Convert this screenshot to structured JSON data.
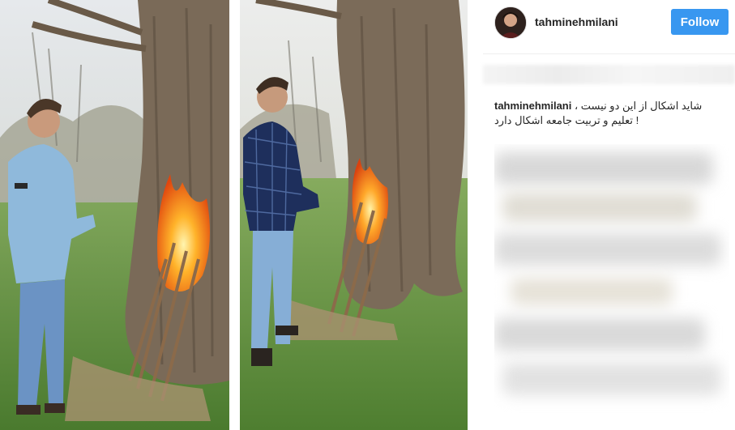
{
  "post": {
    "username": "tahminehmilani",
    "follow_label": "Follow",
    "caption_username": "tahminehmilani",
    "caption_line1": "شاید اشکال از این دو نیست ،",
    "caption_line2": "! تعلیم و تربیت جامعه اشکال دارد"
  },
  "photos": [
    {
      "name": "left-photo",
      "subject": "man in light denim shirt beside burning tree"
    },
    {
      "name": "right-photo",
      "subject": "man in plaid shirt beside burning tree"
    }
  ],
  "icons": [
    "avatar"
  ],
  "colors": {
    "follow_button": "#3897f0",
    "grass": "#5c8a3a",
    "bark": "#6b5a4a",
    "fire": "#ff8a1c",
    "sky": "#e9ecef"
  }
}
